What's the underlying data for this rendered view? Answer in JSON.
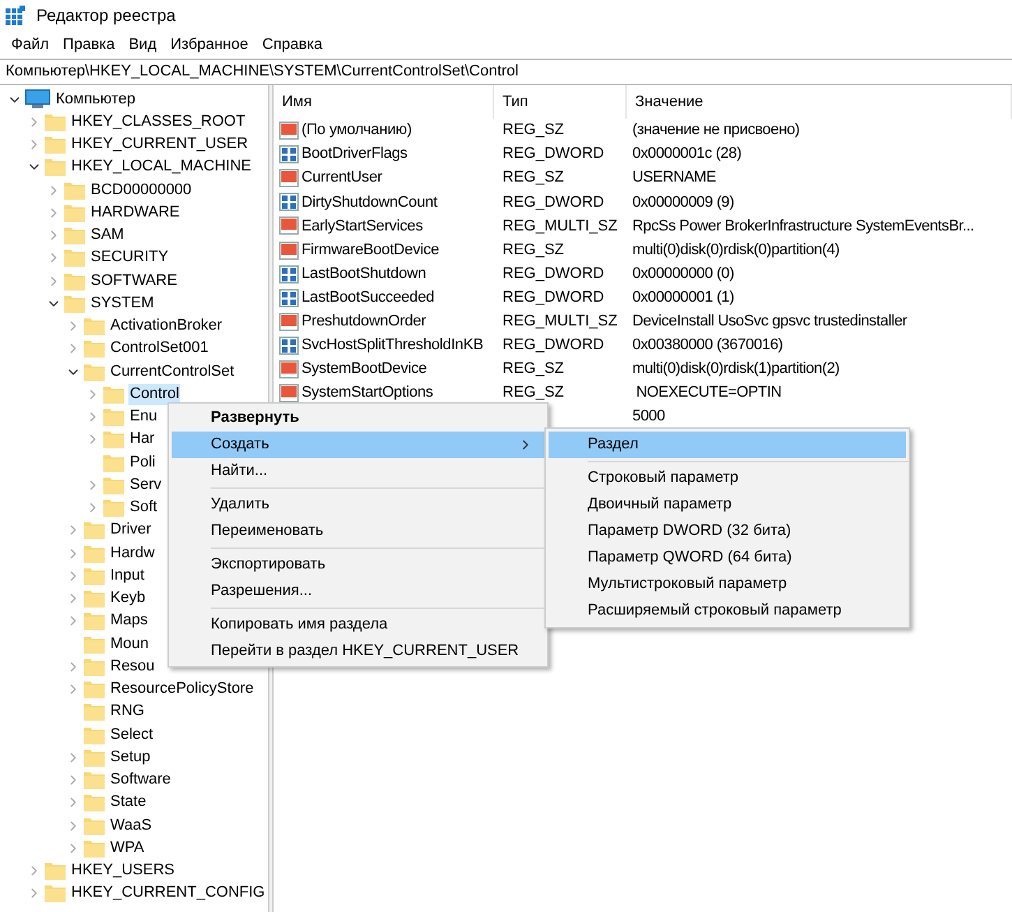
{
  "window": {
    "title": "Редактор реестра"
  },
  "menu_bar": [
    "Файл",
    "Правка",
    "Вид",
    "Избранное",
    "Справка"
  ],
  "address_bar": "Компьютер\\HKEY_LOCAL_MACHINE\\SYSTEM\\CurrentControlSet\\Control",
  "tree": [
    {
      "label": "Компьютер",
      "kind": "computer",
      "expanded": true,
      "selected": false,
      "children": [
        {
          "label": "HKEY_CLASSES_ROOT",
          "kind": "key",
          "expanded": false,
          "selected": false
        },
        {
          "label": "HKEY_CURRENT_USER",
          "kind": "key",
          "expanded": false,
          "selected": false
        },
        {
          "label": "HKEY_LOCAL_MACHINE",
          "kind": "key",
          "expanded": true,
          "selected": false,
          "children": [
            {
              "label": "BCD00000000",
              "kind": "key",
              "expanded": false,
              "selected": false
            },
            {
              "label": "HARDWARE",
              "kind": "key",
              "expanded": false,
              "selected": false
            },
            {
              "label": "SAM",
              "kind": "key",
              "expanded": false,
              "selected": false
            },
            {
              "label": "SECURITY",
              "kind": "key",
              "expanded": false,
              "selected": false
            },
            {
              "label": "SOFTWARE",
              "kind": "key",
              "expanded": false,
              "selected": false
            },
            {
              "label": "SYSTEM",
              "kind": "key",
              "expanded": true,
              "selected": false,
              "children": [
                {
                  "label": "ActivationBroker",
                  "kind": "key",
                  "expanded": false,
                  "selected": false
                },
                {
                  "label": "ControlSet001",
                  "kind": "key",
                  "expanded": false,
                  "selected": false
                },
                {
                  "label": "CurrentControlSet",
                  "kind": "key",
                  "expanded": true,
                  "selected": false,
                  "children": [
                    {
                      "label": "Control",
                      "kind": "key",
                      "expanded": false,
                      "selected": true
                    },
                    {
                      "label": "Enu",
                      "kind": "key",
                      "expanded": false,
                      "selected": false
                    },
                    {
                      "label": "Har",
                      "kind": "key",
                      "expanded": false,
                      "selected": false
                    },
                    {
                      "label": "Poli",
                      "kind": "leaf",
                      "selected": false
                    },
                    {
                      "label": "Serv",
                      "kind": "key",
                      "expanded": false,
                      "selected": false
                    },
                    {
                      "label": "Soft",
                      "kind": "key",
                      "expanded": false,
                      "selected": false
                    }
                  ]
                },
                {
                  "label": "Driver",
                  "kind": "key",
                  "expanded": false,
                  "selected": false
                },
                {
                  "label": "Hardw",
                  "kind": "key",
                  "expanded": false,
                  "selected": false
                },
                {
                  "label": "Input",
                  "kind": "key",
                  "expanded": false,
                  "selected": false
                },
                {
                  "label": "Keyb",
                  "kind": "key",
                  "expanded": false,
                  "selected": false
                },
                {
                  "label": "Maps",
                  "kind": "key",
                  "expanded": false,
                  "selected": false
                },
                {
                  "label": "Moun",
                  "kind": "leaf",
                  "selected": false
                },
                {
                  "label": "Resou",
                  "kind": "key",
                  "expanded": false,
                  "selected": false
                },
                {
                  "label": "ResourcePolicyStore",
                  "kind": "key",
                  "expanded": false,
                  "selected": false
                },
                {
                  "label": "RNG",
                  "kind": "leaf",
                  "selected": false
                },
                {
                  "label": "Select",
                  "kind": "leaf",
                  "selected": false
                },
                {
                  "label": "Setup",
                  "kind": "key",
                  "expanded": false,
                  "selected": false
                },
                {
                  "label": "Software",
                  "kind": "key",
                  "expanded": false,
                  "selected": false
                },
                {
                  "label": "State",
                  "kind": "key",
                  "expanded": false,
                  "selected": false
                },
                {
                  "label": "WaaS",
                  "kind": "key",
                  "expanded": false,
                  "selected": false
                },
                {
                  "label": "WPA",
                  "kind": "key",
                  "expanded": false,
                  "selected": false
                }
              ]
            }
          ]
        },
        {
          "label": "HKEY_USERS",
          "kind": "key",
          "expanded": false,
          "selected": false
        },
        {
          "label": "HKEY_CURRENT_CONFIG",
          "kind": "key",
          "expanded": false,
          "selected": false
        }
      ]
    }
  ],
  "values_table": {
    "columns": [
      "Имя",
      "Тип",
      "Значение"
    ],
    "rows": [
      {
        "kind": "string",
        "name": "(По умолчанию)",
        "type": "REG_SZ",
        "value": "(значение не присвоено)"
      },
      {
        "kind": "binary",
        "name": "BootDriverFlags",
        "type": "REG_DWORD",
        "value": "0x0000001c (28)"
      },
      {
        "kind": "string",
        "name": "CurrentUser",
        "type": "REG_SZ",
        "value": "USERNAME"
      },
      {
        "kind": "binary",
        "name": "DirtyShutdownCount",
        "type": "REG_DWORD",
        "value": "0x00000009 (9)"
      },
      {
        "kind": "string",
        "name": "EarlyStartServices",
        "type": "REG_MULTI_SZ",
        "value": "RpcSs Power BrokerInfrastructure SystemEventsBr..."
      },
      {
        "kind": "string",
        "name": "FirmwareBootDevice",
        "type": "REG_SZ",
        "value": "multi(0)disk(0)rdisk(0)partition(4)"
      },
      {
        "kind": "binary",
        "name": "LastBootShutdown",
        "type": "REG_DWORD",
        "value": "0x00000000 (0)"
      },
      {
        "kind": "binary",
        "name": "LastBootSucceeded",
        "type": "REG_DWORD",
        "value": "0x00000001 (1)"
      },
      {
        "kind": "string",
        "name": "PreshutdownOrder",
        "type": "REG_MULTI_SZ",
        "value": "DeviceInstall UsoSvc gpsvc trustedinstaller"
      },
      {
        "kind": "binary",
        "name": "SvcHostSplitThresholdInKB",
        "type": "REG_DWORD",
        "value": "0x00380000 (3670016)"
      },
      {
        "kind": "string",
        "name": "SystemBootDevice",
        "type": "REG_SZ",
        "value": "multi(0)disk(0)rdisk(1)partition(2)"
      },
      {
        "kind": "string",
        "name": "SystemStartOptions",
        "type": "REG_SZ",
        "value": " NOEXECUTE=OPTIN"
      },
      {
        "kind": "covered",
        "value": "5000"
      }
    ]
  },
  "context_menu": [
    {
      "kind": "item",
      "label": "Развернуть",
      "bold": true,
      "selected": false
    },
    {
      "kind": "item",
      "label": "Создать",
      "submenu": true,
      "selected": true
    },
    {
      "kind": "item",
      "label": "Найти...",
      "selected": false
    },
    {
      "kind": "separator"
    },
    {
      "kind": "item",
      "label": "Удалить",
      "selected": false
    },
    {
      "kind": "item",
      "label": "Переименовать",
      "selected": false
    },
    {
      "kind": "separator"
    },
    {
      "kind": "item",
      "label": "Экспортировать",
      "selected": false
    },
    {
      "kind": "item",
      "label": "Разрешения...",
      "selected": false
    },
    {
      "kind": "separator"
    },
    {
      "kind": "item",
      "label": "Копировать имя раздела",
      "selected": false
    },
    {
      "kind": "item",
      "label": "Перейти в раздел HKEY_CURRENT_USER",
      "selected": false
    }
  ],
  "submenu": [
    {
      "kind": "item",
      "label": "Раздел",
      "selected": true
    },
    {
      "kind": "separator"
    },
    {
      "kind": "item",
      "label": "Строковый параметр",
      "selected": false
    },
    {
      "kind": "item",
      "label": "Двоичный параметр",
      "selected": false
    },
    {
      "kind": "item",
      "label": "Параметр DWORD (32 бита)",
      "selected": false
    },
    {
      "kind": "item",
      "label": "Параметр QWORD (64 бита)",
      "selected": false
    },
    {
      "kind": "item",
      "label": "Мультистроковый параметр",
      "selected": false
    },
    {
      "kind": "item",
      "label": "Расширяемый строковый параметр",
      "selected": false
    }
  ]
}
